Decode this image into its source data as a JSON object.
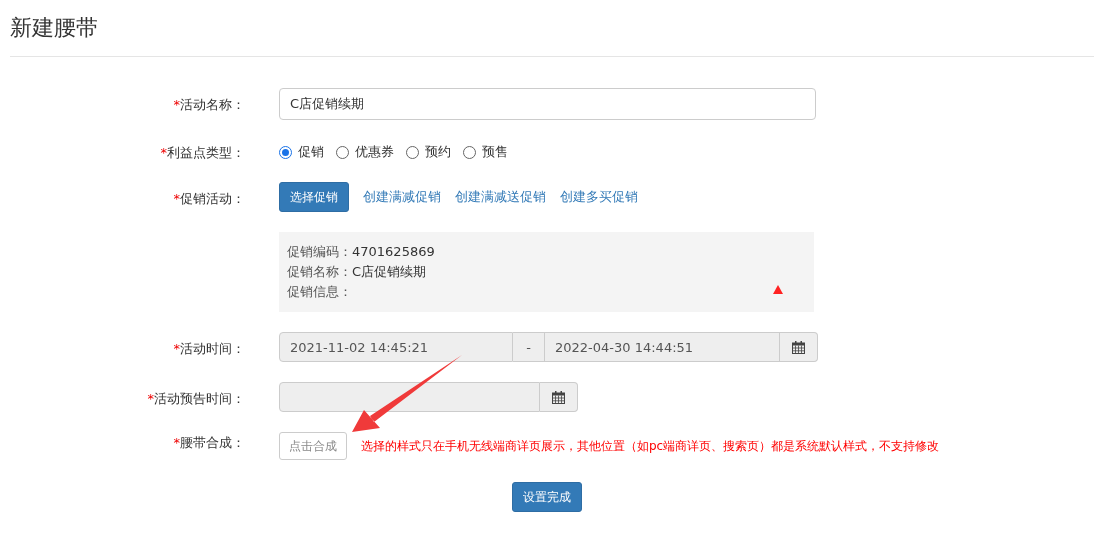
{
  "page_title": "新建腰带",
  "fields": [
    {
      "kind": "text",
      "mark": "*",
      "label": "活动名称：",
      "value": "C店促销续期"
    },
    {
      "kind": "radio",
      "mark": "*",
      "label": "利益点类型：",
      "options": [
        {
          "label": "促销",
          "selected": true
        },
        {
          "label": "优惠券",
          "selected": false
        },
        {
          "label": "预约",
          "selected": false
        },
        {
          "label": "预售",
          "selected": false
        }
      ]
    },
    {
      "kind": "promo",
      "mark": "*",
      "label": "促销活动：",
      "button": "选择促销",
      "links": [
        "创建满减促销",
        "创建满减送促销",
        "创建多买促销"
      ],
      "info": [
        {
          "label": "促销编码：",
          "value": "4701625869"
        },
        {
          "label": "促销名称：",
          "value": "C店促销续期"
        },
        {
          "label": "促销信息："
        }
      ]
    },
    {
      "kind": "daterange",
      "mark": "*",
      "label": "活动时间：",
      "start": "2021-11-02 14:45:21",
      "separator": "-",
      "end": "2022-04-30 14:44:51"
    },
    {
      "kind": "date",
      "mark": "*",
      "label": "活动预告时间："
    },
    {
      "kind": "compose",
      "mark": "*",
      "label": "腰带合成：",
      "button": "点击合成",
      "note": "选择的样式只在手机无线端商详页展示，其他位置（如pc端商详页、搜索页）都是系统默认样式，不支持修改"
    }
  ],
  "submit": "设置完成"
}
